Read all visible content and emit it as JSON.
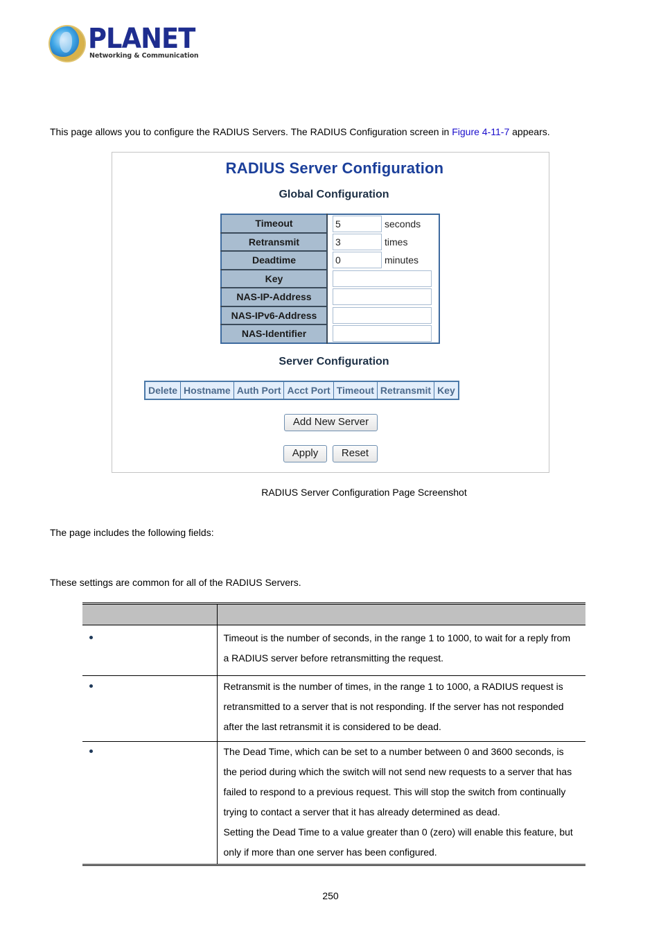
{
  "logo": {
    "brand": "PLANET",
    "tagline": "Networking & Communication"
  },
  "intro": {
    "text_before_link": "This page allows you to configure the RADIUS Servers. The RADIUS Configuration screen in ",
    "link_text": "Figure 4-11-7",
    "text_after_link": " appears.",
    "link_color": "#1a0dcc"
  },
  "screenshot": {
    "title": "RADIUS Server Configuration",
    "title_color": "#1b3f9a",
    "global": {
      "heading": "Global Configuration",
      "rows": [
        {
          "label": "Timeout",
          "value": "5",
          "unit": "seconds"
        },
        {
          "label": "Retransmit",
          "value": "3",
          "unit": "times"
        },
        {
          "label": "Deadtime",
          "value": "0",
          "unit": "minutes"
        },
        {
          "label": "Key",
          "value": ""
        },
        {
          "label": "NAS-IP-Address",
          "value": ""
        },
        {
          "label": "NAS-IPv6-Address",
          "value": ""
        },
        {
          "label": "NAS-Identifier",
          "value": ""
        }
      ]
    },
    "server": {
      "heading": "Server Configuration",
      "columns": [
        "Delete",
        "Hostname",
        "Auth Port",
        "Acct Port",
        "Timeout",
        "Retransmit",
        "Key"
      ]
    },
    "buttons": {
      "add_new_server": "Add New Server",
      "apply": "Apply",
      "reset": "Reset"
    }
  },
  "caption": "RADIUS Server Configuration Page Screenshot",
  "fields_intro": "The page includes the following fields:",
  "section_intro": "These settings are common for all of the RADIUS Servers.",
  "field_table": {
    "headers": [
      "",
      ""
    ],
    "rows": [
      {
        "name": "",
        "description": [
          "Timeout is the number of seconds, in the range 1 to 1000, to wait for a reply from",
          "a RADIUS server before retransmitting the request."
        ]
      },
      {
        "name": "",
        "description": [
          "Retransmit is the number of times, in the range 1 to 1000, a RADIUS request is",
          "retransmitted to a server that is not responding. If the server has not responded",
          "after the last retransmit it is considered to be dead."
        ]
      },
      {
        "name": "",
        "description": [
          "The Dead Time, which can be set to a number between 0 and 3600 seconds, is",
          "the period during which the switch will not send new requests to a server that has",
          "failed to respond to a previous request. This will stop the switch from continually",
          "trying to contact a server that it has already determined as dead.",
          "Setting the Dead Time to a value greater than 0 (zero) will enable this feature, but",
          "only if more than one server has been configured."
        ]
      }
    ]
  },
  "page_number": "250"
}
